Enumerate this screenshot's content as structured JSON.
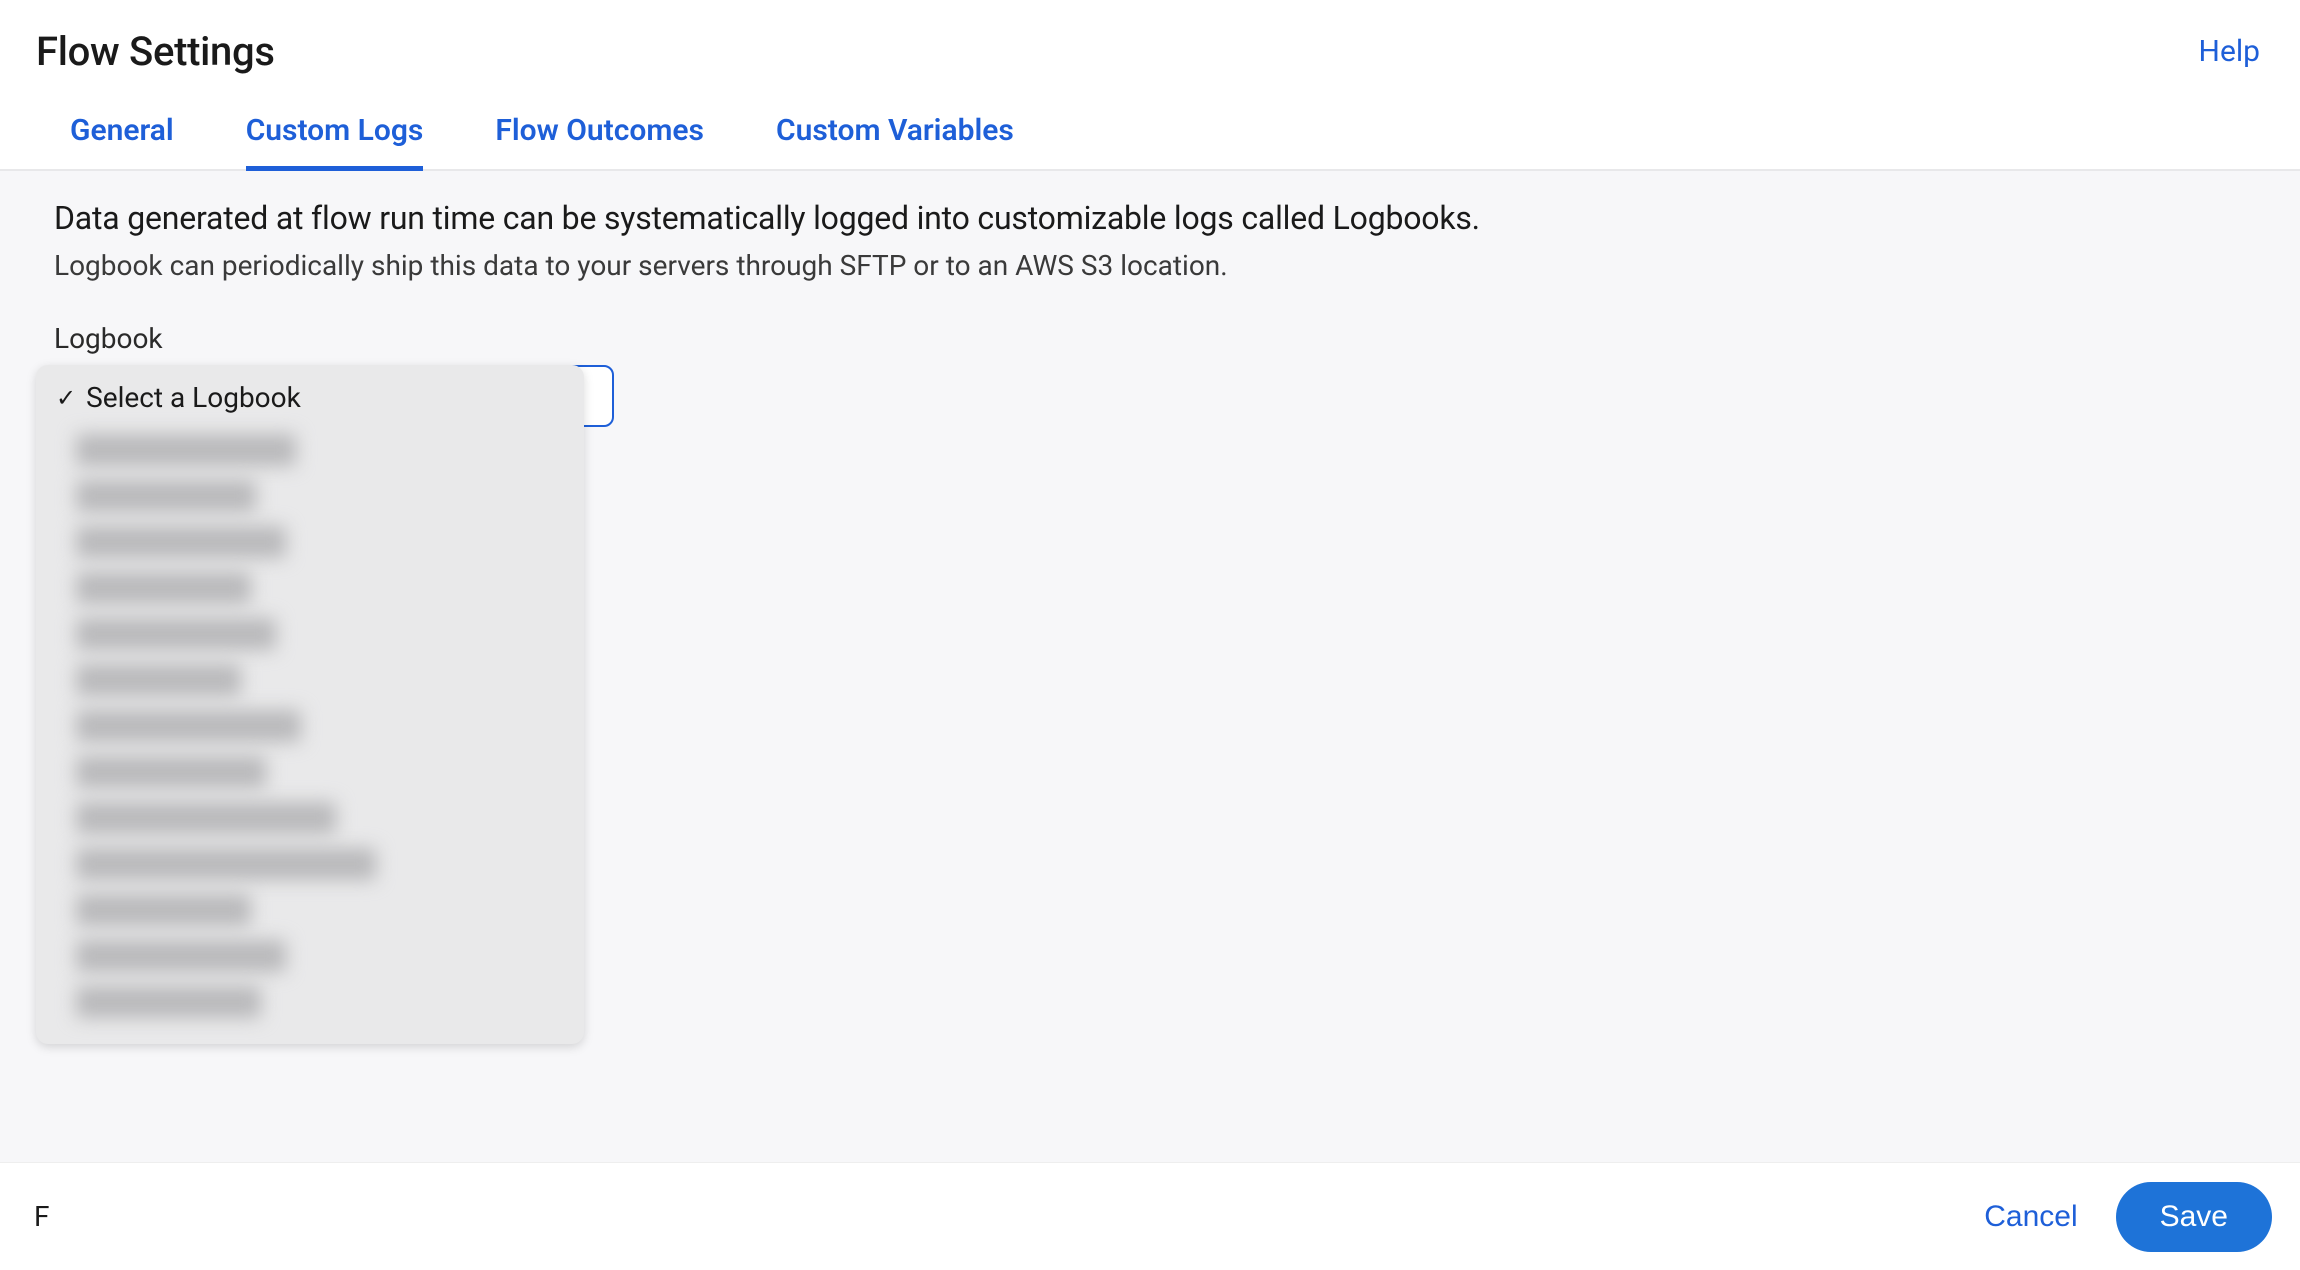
{
  "header": {
    "title": "Flow Settings",
    "help_label": "Help"
  },
  "tabs": [
    {
      "label": "General",
      "active": false
    },
    {
      "label": "Custom Logs",
      "active": true
    },
    {
      "label": "Flow Outcomes",
      "active": false
    },
    {
      "label": "Custom Variables",
      "active": false
    }
  ],
  "content": {
    "heading": "Data generated at flow run time can be systematically logged into customizable logs called Logbooks.",
    "subheading": "Logbook can periodically ship this data to your servers through SFTP or to an AWS S3 location.",
    "field_label": "Logbook",
    "select_placeholder": "Select a Logbook"
  },
  "footer": {
    "left_text_fragment": "F",
    "cancel_label": "Cancel",
    "save_label": "Save"
  }
}
